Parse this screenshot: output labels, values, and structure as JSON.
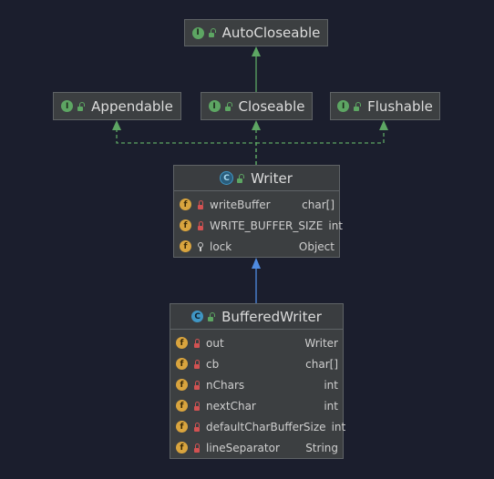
{
  "interfaces": {
    "auto_closeable": {
      "name": "AutoCloseable",
      "kind_letter": "I"
    },
    "appendable": {
      "name": "Appendable",
      "kind_letter": "I"
    },
    "closeable": {
      "name": "Closeable",
      "kind_letter": "I"
    },
    "flushable": {
      "name": "Flushable",
      "kind_letter": "I"
    }
  },
  "writer": {
    "name": "Writer",
    "kind_letter": "C",
    "fields": [
      {
        "name": "writeBuffer",
        "type": "char[]",
        "access": "private"
      },
      {
        "name": "WRITE_BUFFER_SIZE",
        "type": "int",
        "access": "private"
      },
      {
        "name": "lock",
        "type": "Object",
        "access": "protected"
      }
    ]
  },
  "buffered_writer": {
    "name": "BufferedWriter",
    "kind_letter": "C",
    "fields": [
      {
        "name": "out",
        "type": "Writer",
        "access": "private"
      },
      {
        "name": "cb",
        "type": "char[]",
        "access": "private"
      },
      {
        "name": "nChars",
        "type": "int",
        "access": "private"
      },
      {
        "name": "nextChar",
        "type": "int",
        "access": "private"
      },
      {
        "name": "defaultCharBufferSize",
        "type": "int",
        "access": "private"
      },
      {
        "name": "lineSeparator",
        "type": "String",
        "access": "private"
      }
    ]
  },
  "field_badge_letter": "f",
  "colors": {
    "background": "#1b1e2d",
    "interface_badge": "#5da663",
    "class_badge": "#3f96c5",
    "field_badge": "#d9a43e",
    "implements_edge": "#5da663",
    "extends_edge": "#4f8be0"
  }
}
